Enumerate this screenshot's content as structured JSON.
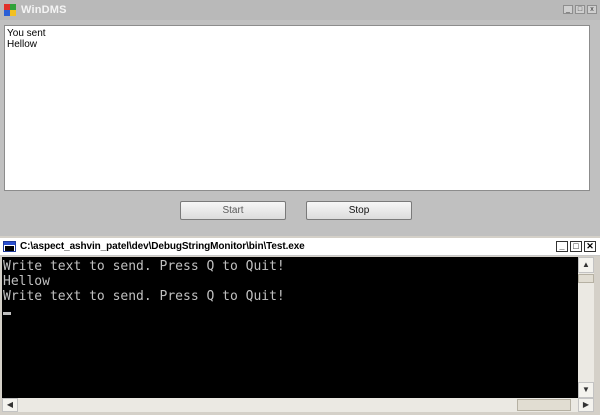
{
  "windms": {
    "title": "WinDMS",
    "message_lines": [
      "You sent",
      "Hellow"
    ],
    "start_label": "Start",
    "stop_label": "Stop"
  },
  "console": {
    "title": "C:\\aspect_ashvin_patel\\dev\\DebugStringMonitor\\bin\\Test.exe",
    "lines": [
      "Write text to send. Press Q to Quit!",
      "Hellow",
      "Write text to send. Press Q to Quit!"
    ],
    "minimize_glyph": "_",
    "maximize_glyph": "□",
    "close_glyph": "✕"
  },
  "colors": {
    "console_bg": "#000000",
    "console_text": "#c0c0c0",
    "window_bg": "#c0c0c0"
  }
}
